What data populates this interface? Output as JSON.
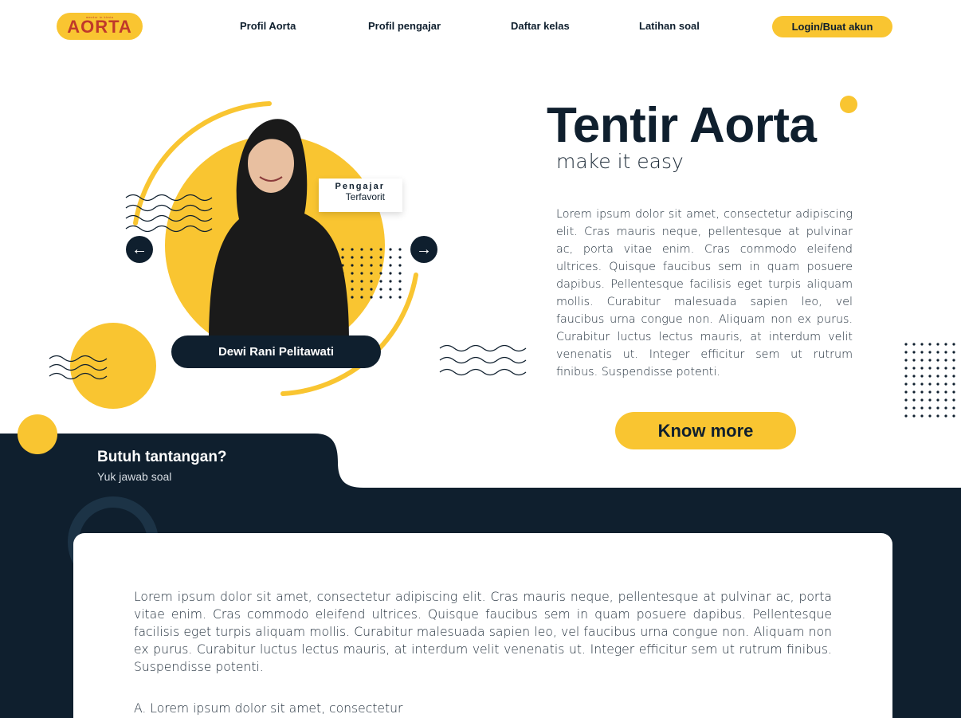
{
  "colors": {
    "accent": "#f9c531",
    "navy": "#0f1f2e",
    "brand_red": "#c0392b",
    "white": "#ffffff"
  },
  "nav": {
    "logo_text": "AORTA",
    "logo_tagline": "mentor in kimia",
    "links": [
      "Profil Aorta",
      "Profil pengajar",
      "Daftar kelas",
      "Latihan soal"
    ],
    "login_label": "Login/Buat akun"
  },
  "teacher": {
    "badge_title": "Pengajar",
    "badge_sub": "Terfavorit",
    "name": "Dewi Rani Pelitawati",
    "prev_icon": "arrow-left-icon",
    "next_icon": "arrow-right-icon"
  },
  "hero": {
    "title": "Tentir Aorta",
    "subtitle": "make it easy",
    "description": "Lorem ipsum dolor sit amet, consectetur adipiscing elit. Cras mauris neque, pellentesque at pulvinar ac, porta vitae enim. Cras commodo eleifend ultrices. Quisque faucibus sem in quam posuere dapibus. Pellentesque facilisis eget turpis aliquam mollis. Curabitur malesuada sapien leo, vel faucibus urna congue non. Aliquam non ex purus. Curabitur luctus lectus mauris, at interdum velit venenatis ut. Integer efficitur sem ut rutrum finibus. Suspendisse potenti.",
    "cta_label": "Know more"
  },
  "challenge": {
    "title": "Butuh tantangan?",
    "subtitle": "Yuk jawab soal",
    "question": "Lorem ipsum dolor sit amet, consectetur adipiscing elit. Cras mauris neque, pellentesque at pulvinar ac, porta vitae enim. Cras commodo eleifend ultrices. Quisque faucibus sem in quam posuere dapibus. Pellentesque facilisis eget turpis aliquam mollis. Curabitur malesuada sapien leo, vel faucibus urna congue non. Aliquam non ex purus. Curabitur luctus lectus mauris, at interdum velit venenatis ut. Integer efficitur sem ut rutrum finibus. Suspendisse potenti.",
    "options": [
      "A. Lorem ipsum dolor sit amet, consectetur"
    ]
  }
}
